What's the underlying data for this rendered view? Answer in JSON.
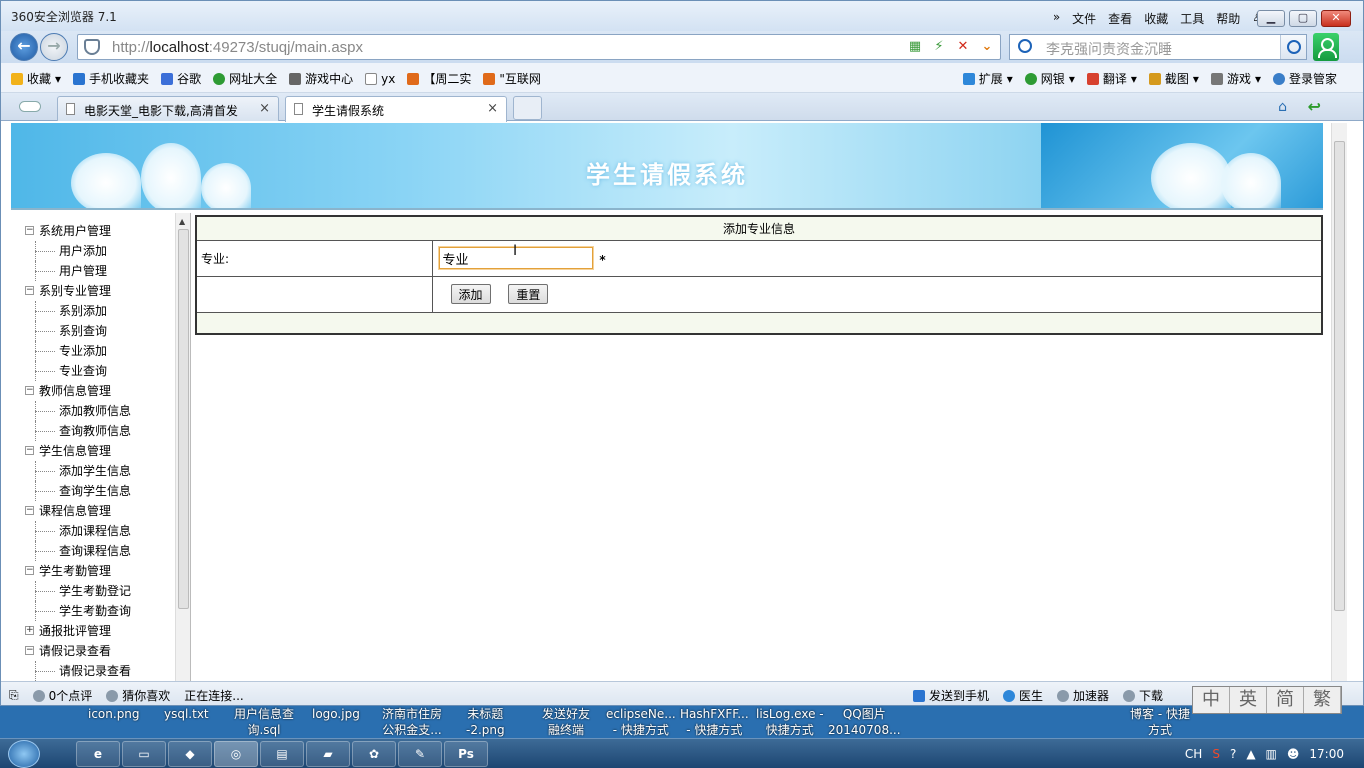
{
  "browser": {
    "title": "360安全浏览器 7.1",
    "menu": [
      "文件",
      "查看",
      "收藏",
      "工具",
      "帮助"
    ],
    "menu_more": "»",
    "url_prefix": "http://",
    "url_host": "localhost",
    "url_rest": ":49273/stuqj/main.aspx",
    "search_placeholder": "李克强问责资金沉睡",
    "bookmarks_left": [
      "收藏",
      "手机收藏夹",
      "谷歌",
      "网址大全",
      "游戏中心",
      "yx",
      "【周二实",
      "\"互联网"
    ],
    "bookmarks_right": [
      "扩展",
      "网银",
      "翻译",
      "截图",
      "游戏",
      "登录管家"
    ],
    "tabs": [
      {
        "label": "电影天堂_电影下载,高清首发",
        "close": "×"
      },
      {
        "label": "学生请假系统",
        "close": "×"
      }
    ]
  },
  "page": {
    "banner_title": "学生请假系统",
    "tree": [
      {
        "label": "系统用户管理",
        "children": [
          "用户添加",
          "用户管理"
        ]
      },
      {
        "label": "系别专业管理",
        "children": [
          "系别添加",
          "系别查询",
          "专业添加",
          "专业查询"
        ]
      },
      {
        "label": "教师信息管理",
        "children": [
          "添加教师信息",
          "查询教师信息"
        ]
      },
      {
        "label": "学生信息管理",
        "children": [
          "添加学生信息",
          "查询学生信息"
        ]
      },
      {
        "label": "课程信息管理",
        "children": [
          "添加课程信息",
          "查询课程信息"
        ]
      },
      {
        "label": "学生考勤管理",
        "children": [
          "学生考勤登记",
          "学生考勤查询"
        ]
      },
      {
        "label": "通报批评管理",
        "children": []
      },
      {
        "label": "请假记录查看",
        "children": [
          "请假记录查看"
        ]
      }
    ],
    "form": {
      "heading": "添加专业信息",
      "field_label": "专业:",
      "field_value": "专业",
      "required_mark": "*",
      "add_button": "添加",
      "reset_button": "重置"
    }
  },
  "status": {
    "left": [
      "0个点评",
      "猜你喜欢",
      "正在连接..."
    ],
    "right": [
      "发送到手机",
      "医生",
      "加速器",
      "下载"
    ]
  },
  "ime": [
    "中",
    "英",
    "简",
    "繁"
  ],
  "desktop": [
    "icon.png",
    "ysql.txt",
    "用户信息查\n询.sql",
    "logo.jpg",
    "济南市住房\n公积金支...",
    "未标题\n-2.png",
    "发送好友\n融终端",
    "eclipseNe...\n- 快捷方式",
    "HashFXFF...\n- 快捷方式",
    "lisLog.exe -\n快捷方式",
    "QQ图片\n20140708...",
    "博客 - 快捷\n方式"
  ],
  "taskbar": {
    "clock": "17:00",
    "tray_lang": "CH"
  },
  "colors": {
    "banner_light": "#c8edfb",
    "banner_dark": "#3ea9dc",
    "focus_border": "#e3a13a",
    "close_red": "#c8301d"
  }
}
